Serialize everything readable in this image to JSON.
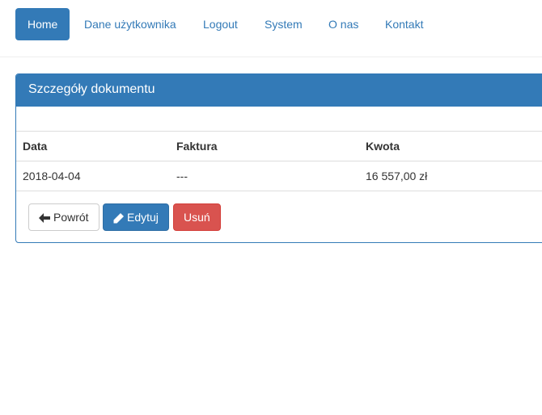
{
  "nav": {
    "items": [
      {
        "label": "Home",
        "active": true
      },
      {
        "label": "Dane użytkownika"
      },
      {
        "label": "Logout"
      },
      {
        "label": "System"
      },
      {
        "label": "O nas"
      },
      {
        "label": "Kontakt"
      }
    ]
  },
  "panel": {
    "title": "Szczegóły dokumentu"
  },
  "table": {
    "headers": [
      "Data",
      "Faktura",
      "Kwota"
    ],
    "rows": [
      [
        "2018-04-04",
        "---",
        "16 557,00 zł"
      ]
    ]
  },
  "actions": {
    "back_label": "Powrót",
    "back_icon": "arrow-left-icon",
    "edit_label": "Edytuj",
    "edit_icon": "pencil-icon",
    "delete_label": "Usuń"
  },
  "colors": {
    "primary": "#337ab7",
    "danger": "#d9534f"
  }
}
